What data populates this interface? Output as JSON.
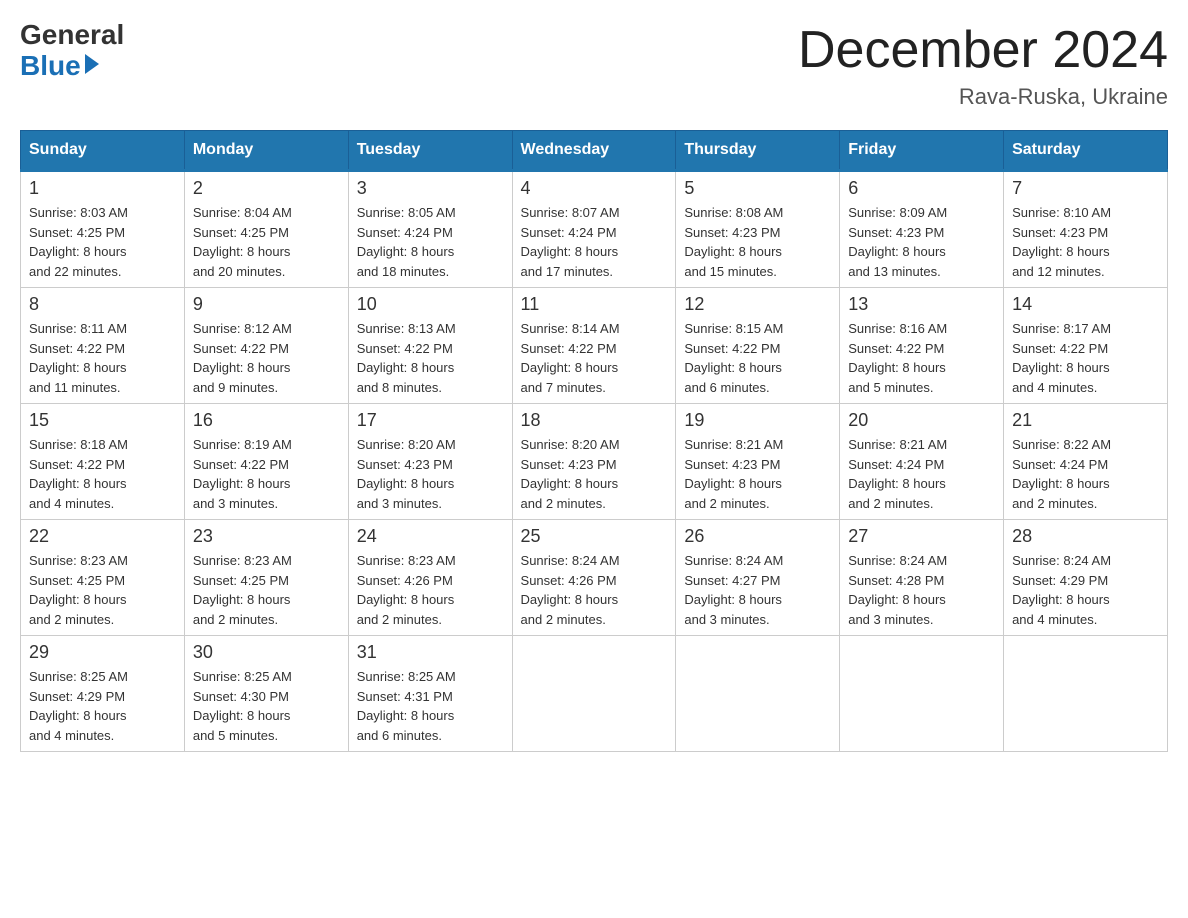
{
  "header": {
    "logo_general": "General",
    "logo_blue": "Blue",
    "month_title": "December 2024",
    "location": "Rava-Ruska, Ukraine"
  },
  "calendar": {
    "days_of_week": [
      "Sunday",
      "Monday",
      "Tuesday",
      "Wednesday",
      "Thursday",
      "Friday",
      "Saturday"
    ],
    "weeks": [
      [
        {
          "day": "1",
          "info": "Sunrise: 8:03 AM\nSunset: 4:25 PM\nDaylight: 8 hours\nand 22 minutes."
        },
        {
          "day": "2",
          "info": "Sunrise: 8:04 AM\nSunset: 4:25 PM\nDaylight: 8 hours\nand 20 minutes."
        },
        {
          "day": "3",
          "info": "Sunrise: 8:05 AM\nSunset: 4:24 PM\nDaylight: 8 hours\nand 18 minutes."
        },
        {
          "day": "4",
          "info": "Sunrise: 8:07 AM\nSunset: 4:24 PM\nDaylight: 8 hours\nand 17 minutes."
        },
        {
          "day": "5",
          "info": "Sunrise: 8:08 AM\nSunset: 4:23 PM\nDaylight: 8 hours\nand 15 minutes."
        },
        {
          "day": "6",
          "info": "Sunrise: 8:09 AM\nSunset: 4:23 PM\nDaylight: 8 hours\nand 13 minutes."
        },
        {
          "day": "7",
          "info": "Sunrise: 8:10 AM\nSunset: 4:23 PM\nDaylight: 8 hours\nand 12 minutes."
        }
      ],
      [
        {
          "day": "8",
          "info": "Sunrise: 8:11 AM\nSunset: 4:22 PM\nDaylight: 8 hours\nand 11 minutes."
        },
        {
          "day": "9",
          "info": "Sunrise: 8:12 AM\nSunset: 4:22 PM\nDaylight: 8 hours\nand 9 minutes."
        },
        {
          "day": "10",
          "info": "Sunrise: 8:13 AM\nSunset: 4:22 PM\nDaylight: 8 hours\nand 8 minutes."
        },
        {
          "day": "11",
          "info": "Sunrise: 8:14 AM\nSunset: 4:22 PM\nDaylight: 8 hours\nand 7 minutes."
        },
        {
          "day": "12",
          "info": "Sunrise: 8:15 AM\nSunset: 4:22 PM\nDaylight: 8 hours\nand 6 minutes."
        },
        {
          "day": "13",
          "info": "Sunrise: 8:16 AM\nSunset: 4:22 PM\nDaylight: 8 hours\nand 5 minutes."
        },
        {
          "day": "14",
          "info": "Sunrise: 8:17 AM\nSunset: 4:22 PM\nDaylight: 8 hours\nand 4 minutes."
        }
      ],
      [
        {
          "day": "15",
          "info": "Sunrise: 8:18 AM\nSunset: 4:22 PM\nDaylight: 8 hours\nand 4 minutes."
        },
        {
          "day": "16",
          "info": "Sunrise: 8:19 AM\nSunset: 4:22 PM\nDaylight: 8 hours\nand 3 minutes."
        },
        {
          "day": "17",
          "info": "Sunrise: 8:20 AM\nSunset: 4:23 PM\nDaylight: 8 hours\nand 3 minutes."
        },
        {
          "day": "18",
          "info": "Sunrise: 8:20 AM\nSunset: 4:23 PM\nDaylight: 8 hours\nand 2 minutes."
        },
        {
          "day": "19",
          "info": "Sunrise: 8:21 AM\nSunset: 4:23 PM\nDaylight: 8 hours\nand 2 minutes."
        },
        {
          "day": "20",
          "info": "Sunrise: 8:21 AM\nSunset: 4:24 PM\nDaylight: 8 hours\nand 2 minutes."
        },
        {
          "day": "21",
          "info": "Sunrise: 8:22 AM\nSunset: 4:24 PM\nDaylight: 8 hours\nand 2 minutes."
        }
      ],
      [
        {
          "day": "22",
          "info": "Sunrise: 8:23 AM\nSunset: 4:25 PM\nDaylight: 8 hours\nand 2 minutes."
        },
        {
          "day": "23",
          "info": "Sunrise: 8:23 AM\nSunset: 4:25 PM\nDaylight: 8 hours\nand 2 minutes."
        },
        {
          "day": "24",
          "info": "Sunrise: 8:23 AM\nSunset: 4:26 PM\nDaylight: 8 hours\nand 2 minutes."
        },
        {
          "day": "25",
          "info": "Sunrise: 8:24 AM\nSunset: 4:26 PM\nDaylight: 8 hours\nand 2 minutes."
        },
        {
          "day": "26",
          "info": "Sunrise: 8:24 AM\nSunset: 4:27 PM\nDaylight: 8 hours\nand 3 minutes."
        },
        {
          "day": "27",
          "info": "Sunrise: 8:24 AM\nSunset: 4:28 PM\nDaylight: 8 hours\nand 3 minutes."
        },
        {
          "day": "28",
          "info": "Sunrise: 8:24 AM\nSunset: 4:29 PM\nDaylight: 8 hours\nand 4 minutes."
        }
      ],
      [
        {
          "day": "29",
          "info": "Sunrise: 8:25 AM\nSunset: 4:29 PM\nDaylight: 8 hours\nand 4 minutes."
        },
        {
          "day": "30",
          "info": "Sunrise: 8:25 AM\nSunset: 4:30 PM\nDaylight: 8 hours\nand 5 minutes."
        },
        {
          "day": "31",
          "info": "Sunrise: 8:25 AM\nSunset: 4:31 PM\nDaylight: 8 hours\nand 6 minutes."
        },
        {
          "day": "",
          "info": ""
        },
        {
          "day": "",
          "info": ""
        },
        {
          "day": "",
          "info": ""
        },
        {
          "day": "",
          "info": ""
        }
      ]
    ]
  }
}
